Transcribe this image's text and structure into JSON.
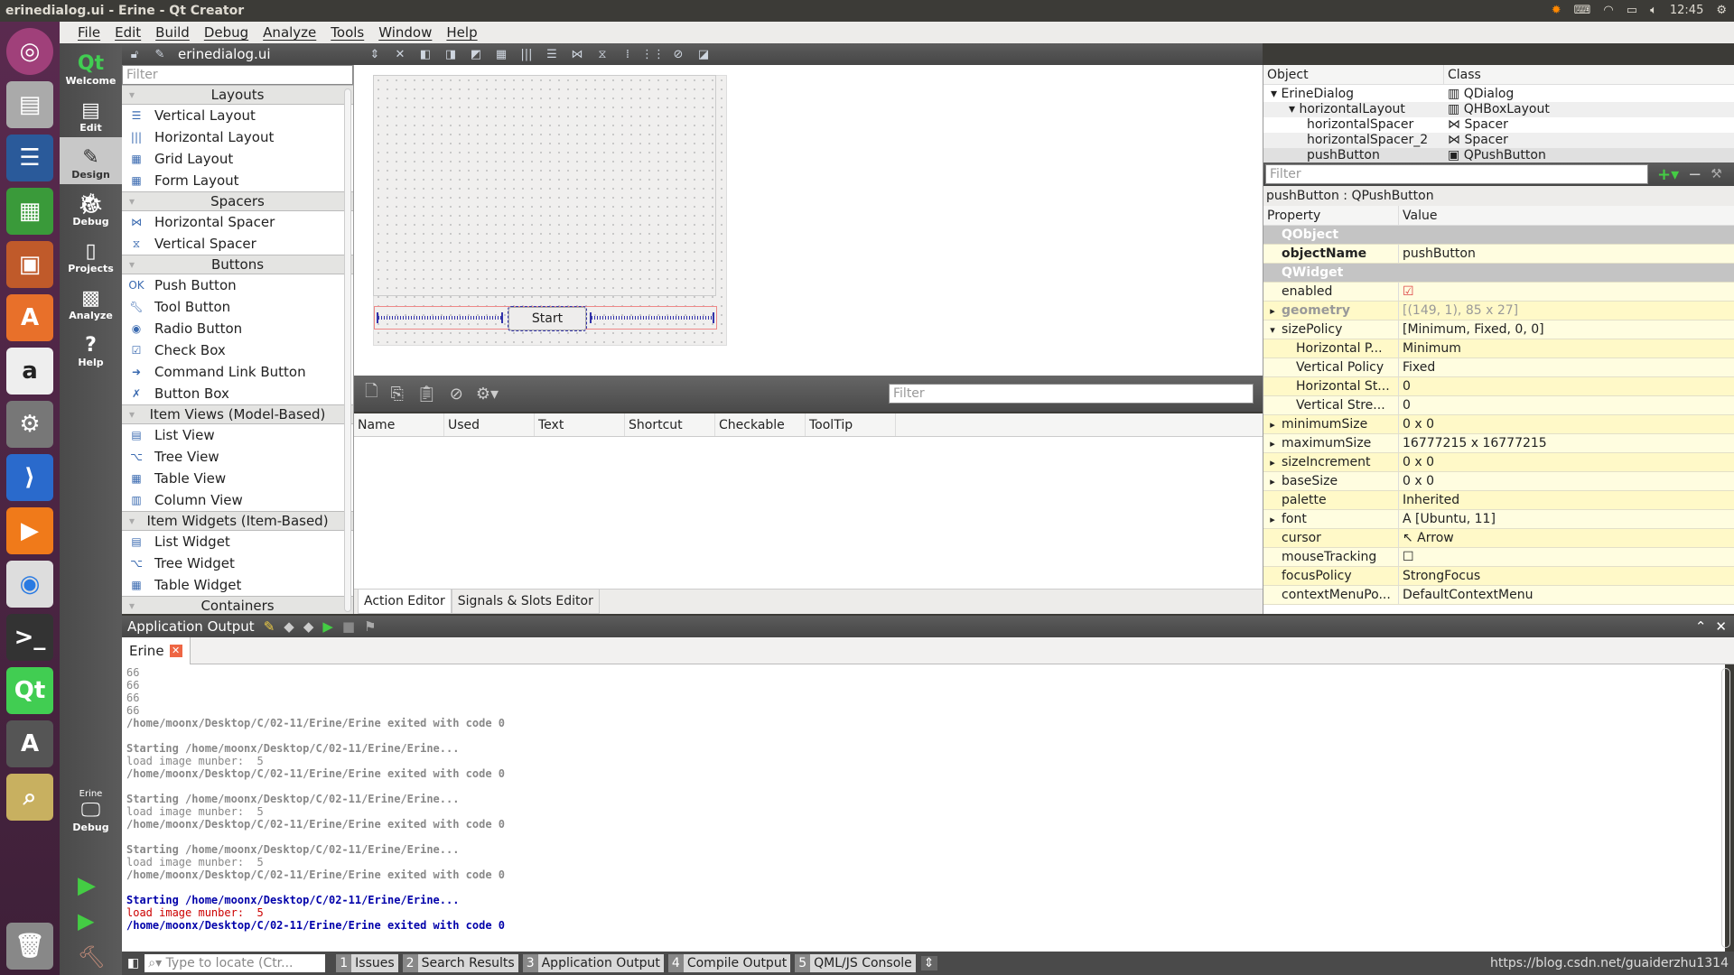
{
  "window": {
    "title": "erinedialog.ui - Erine - Qt Creator",
    "clock": "12:45"
  },
  "menu": [
    "File",
    "Edit",
    "Build",
    "Debug",
    "Analyze",
    "Tools",
    "Window",
    "Help"
  ],
  "modes": [
    {
      "label": "Welcome",
      "icon": "qt-logo-icon"
    },
    {
      "label": "Edit",
      "icon": "document-icon"
    },
    {
      "label": "Design",
      "icon": "design-icon"
    },
    {
      "label": "Debug",
      "icon": "bug-icon"
    },
    {
      "label": "Projects",
      "icon": "folder-icon"
    },
    {
      "label": "Analyze",
      "icon": "monitor-icon"
    },
    {
      "label": "Help",
      "icon": "help-icon"
    }
  ],
  "mode_active": "Design",
  "run_target": {
    "project": "Erine",
    "mode": "Debug"
  },
  "editor": {
    "filename": "erinedialog.ui"
  },
  "widgetbox": {
    "filter_placeholder": "Filter",
    "categories": [
      {
        "name": "Layouts",
        "items": [
          "Vertical Layout",
          "Horizontal Layout",
          "Grid Layout",
          "Form Layout"
        ]
      },
      {
        "name": "Spacers",
        "items": [
          "Horizontal Spacer",
          "Vertical Spacer"
        ]
      },
      {
        "name": "Buttons",
        "items": [
          "Push Button",
          "Tool Button",
          "Radio Button",
          "Check Box",
          "Command Link Button",
          "Button Box"
        ]
      },
      {
        "name": "Item Views (Model-Based)",
        "items": [
          "List View",
          "Tree View",
          "Table View",
          "Column View"
        ]
      },
      {
        "name": "Item Widgets (Item-Based)",
        "items": [
          "List Widget",
          "Tree Widget",
          "Table Widget"
        ]
      },
      {
        "name": "Containers",
        "items": []
      }
    ]
  },
  "form": {
    "button_label": "Start"
  },
  "action_editor": {
    "filter_placeholder": "Filter",
    "columns": [
      "Name",
      "Used",
      "Text",
      "Shortcut",
      "Checkable",
      "ToolTip"
    ],
    "tabs": [
      "Action Editor",
      "Signals & Slots Editor"
    ]
  },
  "object_inspector": {
    "columns": [
      "Object",
      "Class"
    ],
    "rows": [
      {
        "object": "ErineDialog",
        "class": "QDialog",
        "level": 0
      },
      {
        "object": "horizontalLayout",
        "class": "QHBoxLayout",
        "level": 1
      },
      {
        "object": "horizontalSpacer",
        "class": "Spacer",
        "level": 2
      },
      {
        "object": "horizontalSpacer_2",
        "class": "Spacer",
        "level": 2
      },
      {
        "object": "pushButton",
        "class": "QPushButton",
        "level": 2
      }
    ]
  },
  "property_editor": {
    "filter_placeholder": "Filter",
    "selected": "pushButton : QPushButton",
    "columns": [
      "Property",
      "Value"
    ],
    "rows": [
      {
        "name": "QObject",
        "value": "",
        "group": true
      },
      {
        "name": "objectName",
        "value": "pushButton",
        "bold": true
      },
      {
        "name": "QWidget",
        "value": "",
        "group": true
      },
      {
        "name": "enabled",
        "value": "☑"
      },
      {
        "name": "geometry",
        "value": "[(149, 1), 85 x 27]",
        "expand": "▸",
        "dim": true
      },
      {
        "name": "sizePolicy",
        "value": "[Minimum, Fixed, 0, 0]",
        "expand": "▾"
      },
      {
        "name": "Horizontal P...",
        "value": "Minimum",
        "indent": true
      },
      {
        "name": "Vertical Policy",
        "value": "Fixed",
        "indent": true
      },
      {
        "name": "Horizontal St...",
        "value": "0",
        "indent": true
      },
      {
        "name": "Vertical Stre...",
        "value": "0",
        "indent": true
      },
      {
        "name": "minimumSize",
        "value": "0 x 0",
        "expand": "▸"
      },
      {
        "name": "maximumSize",
        "value": "16777215 x 16777215",
        "expand": "▸"
      },
      {
        "name": "sizeIncrement",
        "value": "0 x 0",
        "expand": "▸"
      },
      {
        "name": "baseSize",
        "value": "0 x 0",
        "expand": "▸"
      },
      {
        "name": "palette",
        "value": "Inherited"
      },
      {
        "name": "font",
        "value": "A  [Ubuntu, 11]",
        "expand": "▸"
      },
      {
        "name": "cursor",
        "value": "↖  Arrow"
      },
      {
        "name": "mouseTracking",
        "value": "☐"
      },
      {
        "name": "focusPolicy",
        "value": "StrongFocus"
      },
      {
        "name": "contextMenuPo...",
        "value": "DefaultContextMenu"
      }
    ]
  },
  "output": {
    "title": "Application Output",
    "tab": "Erine",
    "lines": [
      {
        "t": "66",
        "c": "#888",
        "w": "normal"
      },
      {
        "t": "66",
        "c": "#888",
        "w": "normal"
      },
      {
        "t": "66",
        "c": "#888",
        "w": "normal"
      },
      {
        "t": "66",
        "c": "#888",
        "w": "normal"
      },
      {
        "t": "/home/moonx/Desktop/C/02-11/Erine/Erine exited with code 0",
        "c": "#888"
      },
      {
        "t": "",
        "c": "#888"
      },
      {
        "t": "Starting /home/moonx/Desktop/C/02-11/Erine/Erine...",
        "c": "#888"
      },
      {
        "t": "load image munber:  5",
        "c": "#888",
        "w": "normal"
      },
      {
        "t": "/home/moonx/Desktop/C/02-11/Erine/Erine exited with code 0",
        "c": "#888"
      },
      {
        "t": "",
        "c": "#888"
      },
      {
        "t": "Starting /home/moonx/Desktop/C/02-11/Erine/Erine...",
        "c": "#888"
      },
      {
        "t": "load image munber:  5",
        "c": "#888",
        "w": "normal"
      },
      {
        "t": "/home/moonx/Desktop/C/02-11/Erine/Erine exited with code 0",
        "c": "#888"
      },
      {
        "t": "",
        "c": "#888"
      },
      {
        "t": "Starting /home/moonx/Desktop/C/02-11/Erine/Erine...",
        "c": "#888"
      },
      {
        "t": "load image munber:  5",
        "c": "#888",
        "w": "normal"
      },
      {
        "t": "/home/moonx/Desktop/C/02-11/Erine/Erine exited with code 0",
        "c": "#888"
      },
      {
        "t": "",
        "c": "#888"
      },
      {
        "t": "Starting /home/moonx/Desktop/C/02-11/Erine/Erine...",
        "c": "#0000aa"
      },
      {
        "t": "load image munber:  5",
        "c": "#cc0000",
        "w": "normal"
      },
      {
        "t": "/home/moonx/Desktop/C/02-11/Erine/Erine exited with code 0",
        "c": "#0000aa"
      }
    ]
  },
  "statusbar": {
    "locator_placeholder": "Type to locate (Ctr...",
    "panes": [
      {
        "n": "1",
        "label": "Issues"
      },
      {
        "n": "2",
        "label": "Search Results"
      },
      {
        "n": "3",
        "label": "Application Output"
      },
      {
        "n": "4",
        "label": "Compile Output"
      },
      {
        "n": "5",
        "label": "QML/JS Console"
      }
    ],
    "watermark": "https://blog.csdn.net/guaiderzhu1314"
  }
}
